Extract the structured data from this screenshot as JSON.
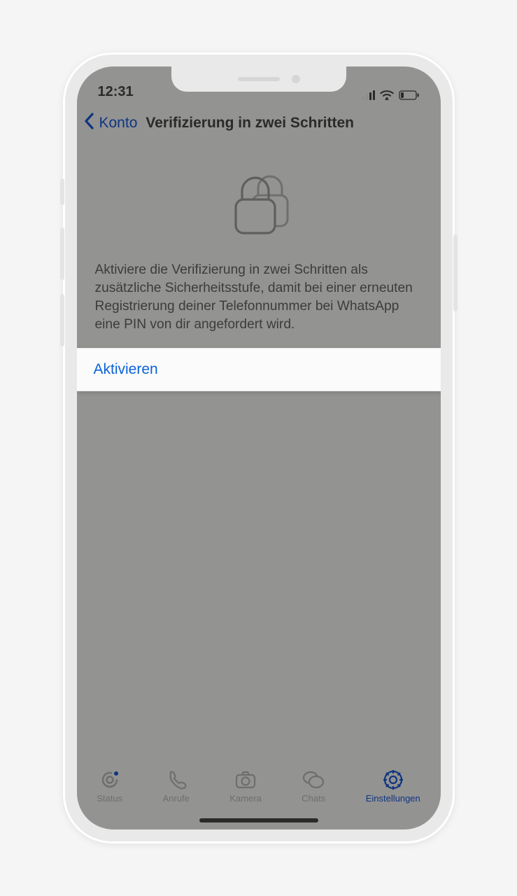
{
  "status": {
    "time": "12:31"
  },
  "nav": {
    "back_label": "Konto",
    "title": "Verifizierung in zwei Schritten"
  },
  "main": {
    "description": "Aktiviere die Verifizierung in zwei Schritten als zusätzliche Sicherheitsstufe, damit bei einer erneuten Registrierung deiner Telefonnummer bei WhatsApp eine PIN von dir angefordert wird.",
    "activate_label": "Aktivieren"
  },
  "tabs": {
    "status": "Status",
    "calls": "Anrufe",
    "camera": "Kamera",
    "chats": "Chats",
    "settings": "Einstellungen"
  }
}
